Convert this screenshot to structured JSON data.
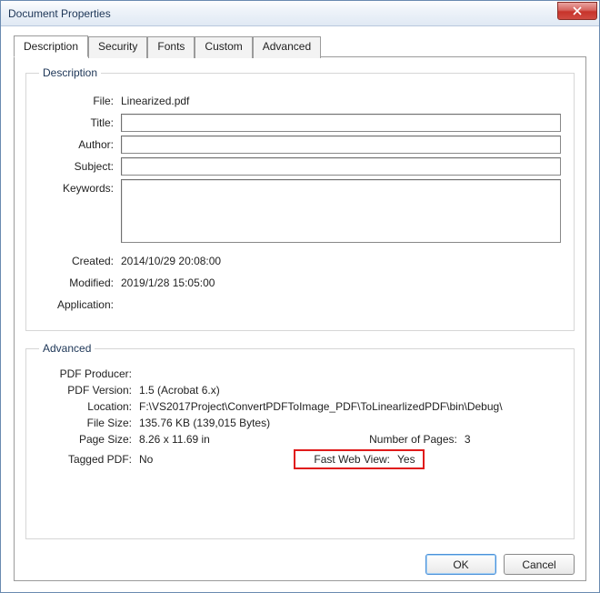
{
  "window": {
    "title": "Document Properties"
  },
  "tabs": {
    "description": "Description",
    "security": "Security",
    "fonts": "Fonts",
    "custom": "Custom",
    "advanced": "Advanced"
  },
  "group_description": {
    "legend": "Description",
    "labels": {
      "file": "File:",
      "title": "Title:",
      "author": "Author:",
      "subject": "Subject:",
      "keywords": "Keywords:",
      "created": "Created:",
      "modified": "Modified:",
      "application": "Application:"
    },
    "values": {
      "file": "Linearized.pdf",
      "title": "",
      "author": "",
      "subject": "",
      "keywords": "",
      "created": "2014/10/29 20:08:00",
      "modified": "2019/1/28 15:05:00",
      "application": ""
    }
  },
  "group_advanced": {
    "legend": "Advanced",
    "labels": {
      "pdf_producer": "PDF Producer:",
      "pdf_version": "PDF Version:",
      "location": "Location:",
      "file_size": "File Size:",
      "page_size": "Page Size:",
      "number_of_pages": "Number of Pages:",
      "tagged_pdf": "Tagged PDF:",
      "fast_web_view": "Fast Web View:"
    },
    "values": {
      "pdf_producer": "",
      "pdf_version": "1.5 (Acrobat 6.x)",
      "location": "F:\\VS2017Project\\ConvertPDFToImage_PDF\\ToLinearlizedPDF\\bin\\Debug\\",
      "file_size": "135.76 KB (139,015 Bytes)",
      "page_size": "8.26 x 11.69 in",
      "number_of_pages": "3",
      "tagged_pdf": "No",
      "fast_web_view": "Yes"
    }
  },
  "buttons": {
    "ok": "OK",
    "cancel": "Cancel"
  }
}
